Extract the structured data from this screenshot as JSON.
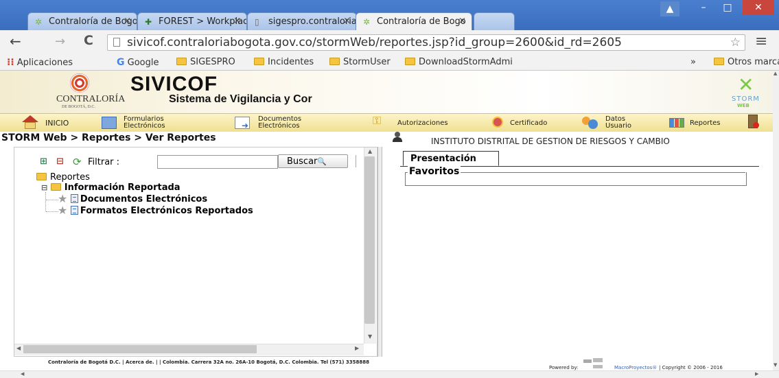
{
  "browser": {
    "tabs": [
      {
        "title": "Contraloría de Bogo",
        "active": false
      },
      {
        "title": "FOREST > Workplac",
        "active": false
      },
      {
        "title": "sigespro.contraloria",
        "active": false
      },
      {
        "title": "Contraloría de Bogo",
        "active": true
      }
    ],
    "tab_close": "×",
    "window_buttons": {
      "minimize": "–",
      "maximize": "□",
      "close": "✕",
      "user": "▲"
    },
    "nav": {
      "back": "←",
      "forward": "→",
      "reload": "C",
      "star": "☆",
      "menu": "≡"
    },
    "url": "sivicof.contraloriabogota.gov.co/stormWeb/reportes.jsp?id_group=2600&id_rd=2605",
    "bookmarks": {
      "apps": "Aplicaciones",
      "items": [
        "Google",
        "SIGESPRO",
        "Incidentes",
        "StormUser",
        "DownloadStormAdmi"
      ],
      "overflow": "»",
      "other": "Otros marcadores"
    }
  },
  "header": {
    "org_name": "CONTRALORÍA",
    "org_sub": "DE BOGOTÁ, D.C.",
    "system_title": "SIVICOF",
    "system_subtitle": "Sistema de Vigilancia y Cor",
    "storm_logo": "STORM",
    "storm_sub": "WEB"
  },
  "menu": {
    "inicio": "INICIO",
    "formularios": [
      "Formularios",
      "Electrónicos"
    ],
    "documentos": [
      "Documentos",
      "Electrónicos"
    ],
    "autorizaciones": "Autorizaciones",
    "certificado": "Certificado",
    "datos": [
      "Datos",
      "Usuario"
    ],
    "reportes": "Reportes"
  },
  "breadcrumb": "STORM Web > Reportes > Ver Reportes",
  "entity": "INSTITUTO DISTRITAL DE GESTION DE RIESGOS Y CAMBIO",
  "filter": {
    "label": "Filtrar :",
    "value": "",
    "button": "Buscar"
  },
  "tree": {
    "root": "Reportes",
    "group": "Información Reportada",
    "expander": "⊟",
    "items": [
      "Documentos Electrónicos",
      "Formatos Electrónicos Reportados"
    ]
  },
  "right": {
    "tab": "Presentación",
    "fieldset": "Favoritos"
  },
  "footer": {
    "text": "Contraloría de Bogotá D.C.  | Acerca de.  | | Colombia. Carrera 32A no. 26A-10 Bogotá, D.C. Colombia. Tel (571) 3358888",
    "powered": "Powered by:",
    "brand": "MacroProyectos®",
    "copyright": "| Copyright © 2006 - 2016"
  },
  "colors": {
    "menu_bg": "#f0e08f",
    "title_red": "#c0272d",
    "chrome_blue": "#3a6dbd"
  }
}
